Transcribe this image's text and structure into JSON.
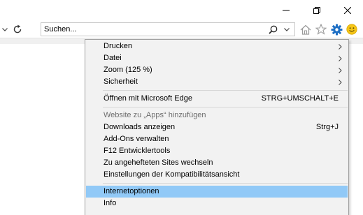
{
  "window": {
    "minimize_label": "Minimieren",
    "maximize_label": "Maximieren",
    "close_label": "Schließen"
  },
  "toolbar": {
    "search": {
      "placeholder": "Suchen..."
    },
    "icons": [
      "chevron-down-icon",
      "refresh-icon",
      "search-icon",
      "home-icon",
      "favorites-star-icon",
      "tools-gear-icon",
      "smiley-icon"
    ]
  },
  "menu": {
    "items": [
      {
        "label": "Drucken",
        "submenu": true
      },
      {
        "label": "Datei",
        "submenu": true
      },
      {
        "label": "Zoom (125 %)",
        "submenu": true
      },
      {
        "label": "Sicherheit",
        "submenu": true
      },
      {
        "label": "Öffnen mit Microsoft Edge",
        "shortcut": "STRG+UMSCHALT+E"
      },
      {
        "label": "Website zu „Apps“ hinzufügen",
        "disabled": true
      },
      {
        "label": "Downloads anzeigen",
        "shortcut": "Strg+J"
      },
      {
        "label": "Add-Ons verwalten"
      },
      {
        "label": "F12 Entwicklertools"
      },
      {
        "label": "Zu angehefteten Sites wechseln"
      },
      {
        "label": "Einstellungen der Kompatibilitätsansicht"
      },
      {
        "label": "Internetoptionen",
        "highlighted": true
      },
      {
        "label": "Info"
      }
    ]
  },
  "colors": {
    "menu_background": "#f2f2f2",
    "highlight": "#91c9f7",
    "gear_icon": "#1e6fc4",
    "smiley_icon": "#f5c518",
    "disabled_text": "#6d6d6d"
  }
}
